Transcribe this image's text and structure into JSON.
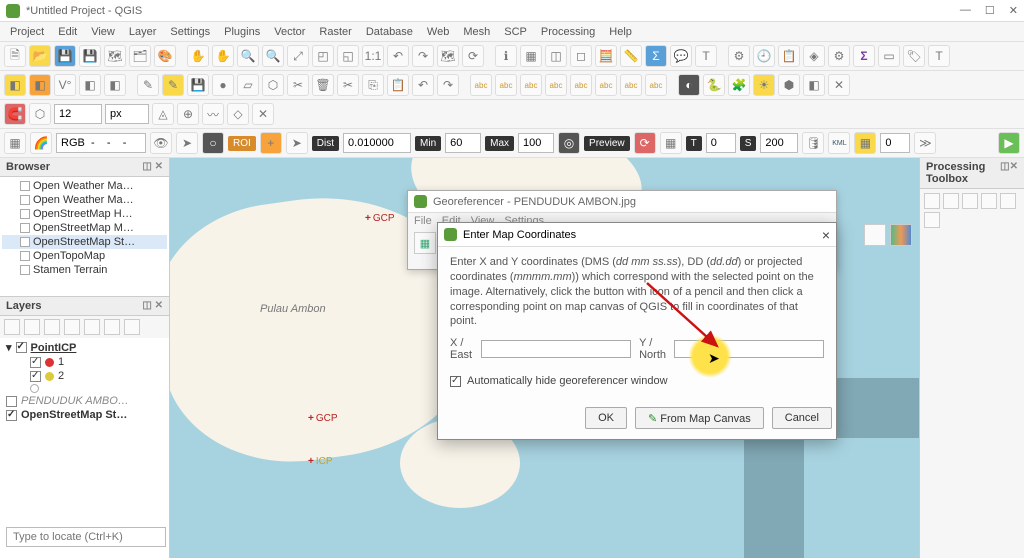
{
  "window": {
    "title": "*Untitled Project - QGIS"
  },
  "menu": [
    "Project",
    "Edit",
    "View",
    "Layer",
    "Settings",
    "Plugins",
    "Vector",
    "Raster",
    "Database",
    "Web",
    "Mesh",
    "SCP",
    "Processing",
    "Help"
  ],
  "toolbar3": {
    "size_value": "12",
    "unit_value": "px"
  },
  "toolbar4": {
    "rgb_label": "RGB  -    -    -",
    "roi_label": "ROI",
    "dist_label": "Dist",
    "dist_value": "0.010000",
    "min_label": "Min",
    "min_value": "60",
    "max_label": "Max",
    "max_value": "100",
    "preview_label": "Preview",
    "t_label": "T",
    "t_value": "0",
    "s_label": "S",
    "s_value": "200",
    "zero": "0"
  },
  "browser": {
    "title": "Browser",
    "items": [
      "Open Weather Ma…",
      "Open Weather Ma…",
      "OpenStreetMap H…",
      "OpenStreetMap M…",
      "OpenStreetMap St…",
      "OpenTopoMap",
      "Stamen Terrain"
    ]
  },
  "layers": {
    "title": "Layers",
    "point_group": "PointICP",
    "pt1": "1",
    "pt2": "2",
    "penduduk": "PENDUDUK AMBO…",
    "osm": "OpenStreetMap St…"
  },
  "processing": {
    "title": "Processing Toolbox"
  },
  "locator": {
    "placeholder": "Type to locate (Ctrl+K)"
  },
  "map": {
    "label_pulau": "Pulau Ambon",
    "gcp": "GCP",
    "icp": "ICP"
  },
  "georef": {
    "title": "Georeferencer - PENDUDUK AMBON.jpg",
    "menu": [
      "File",
      "Edit",
      "View",
      "Settings"
    ]
  },
  "dialog": {
    "title": "Enter Map Coordinates",
    "instr_pre": "Enter X and Y coordinates (DMS (",
    "instr_dms": "dd mm ss.ss",
    "instr_mid1": "), DD (",
    "instr_dd": "dd.dd",
    "instr_mid2": ") or projected coordinates (",
    "instr_proj": "mmmm.mm",
    "instr_post": ")) which correspond with the selected point on the image. Alternatively, click the button with icon of a pencil and then click a corresponding point on map canvas of QGIS to fill in coordinates of that point.",
    "x_label": "X / East",
    "y_label": "Y / North",
    "auto_hide": "Automatically hide georeferencer window",
    "btn_ok": "OK",
    "btn_from": "From Map Canvas",
    "btn_cancel": "Cancel"
  }
}
